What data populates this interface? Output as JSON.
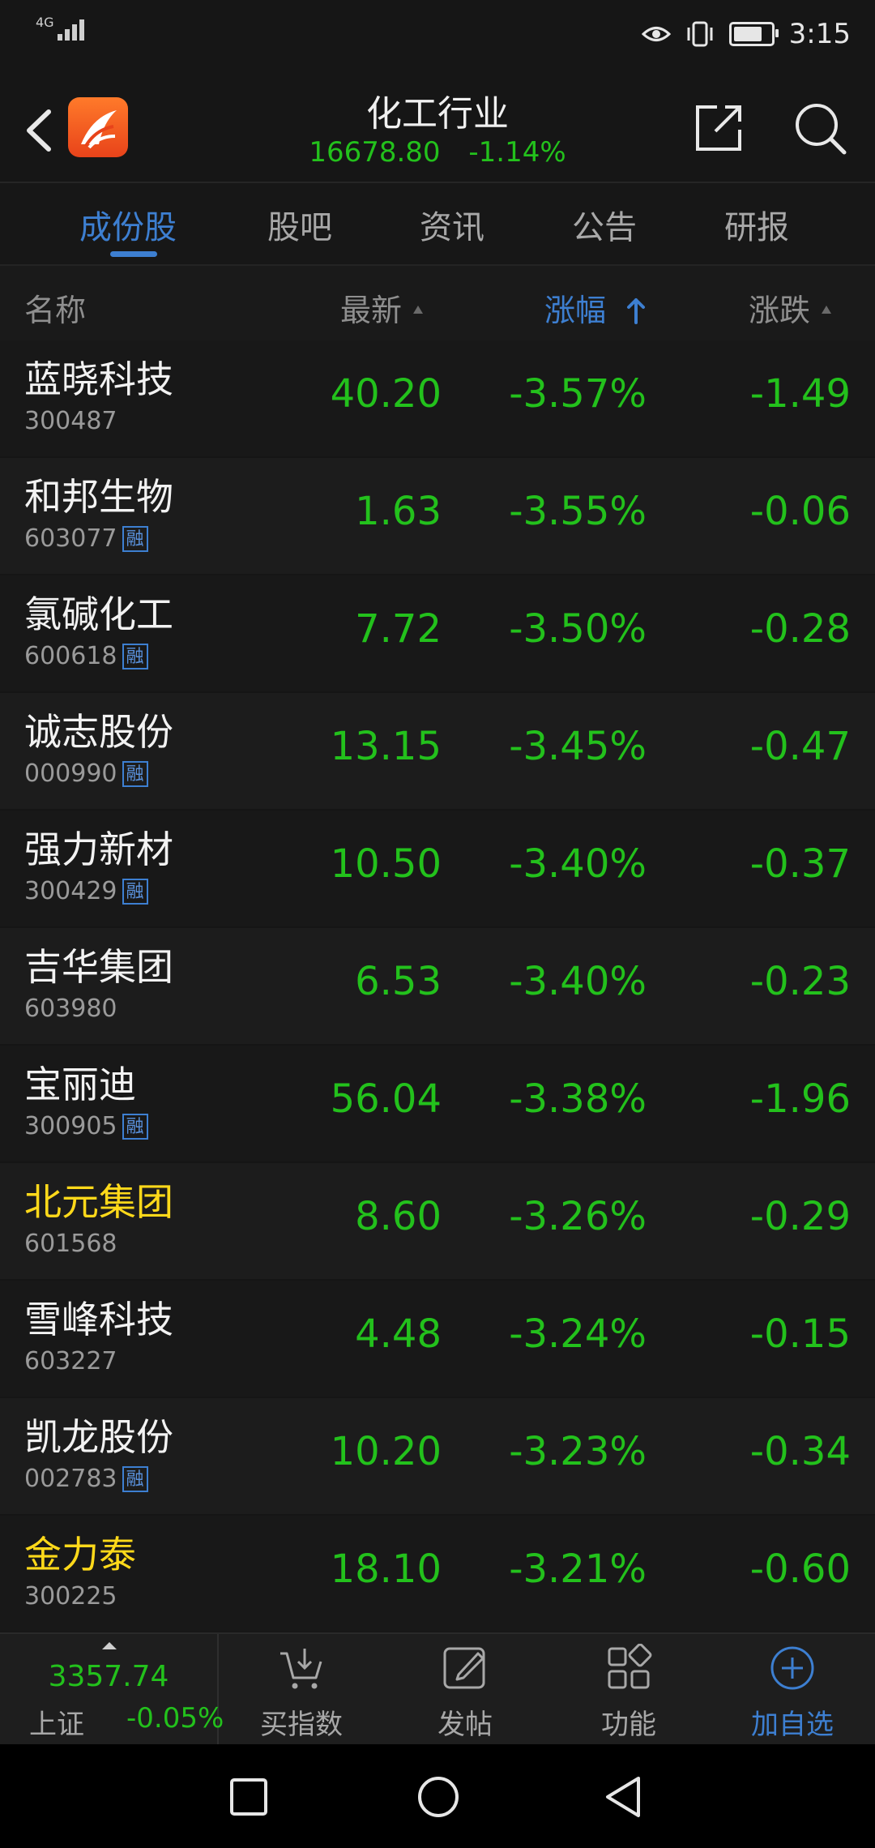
{
  "status_bar": {
    "network": "4G",
    "time": "3:15",
    "icons": [
      "signal-icon",
      "eye-icon",
      "vibrate-icon",
      "battery-icon"
    ]
  },
  "header": {
    "title": "化工行业",
    "index_value": "16678.80",
    "index_change": "-1.14%"
  },
  "tabs": [
    {
      "label": "成份股",
      "active": true
    },
    {
      "label": "股吧",
      "active": false
    },
    {
      "label": "资讯",
      "active": false
    },
    {
      "label": "公告",
      "active": false
    },
    {
      "label": "研报",
      "active": false
    }
  ],
  "columns": {
    "name": "名称",
    "latest": "最新",
    "change_pct": "涨幅",
    "change": "涨跌"
  },
  "rows": [
    {
      "name": "蓝晓科技",
      "code": "300487",
      "margin": false,
      "highlight": false,
      "latest": "40.20",
      "pct": "-3.57%",
      "chg": "-1.49"
    },
    {
      "name": "和邦生物",
      "code": "603077",
      "margin": true,
      "highlight": false,
      "latest": "1.63",
      "pct": "-3.55%",
      "chg": "-0.06"
    },
    {
      "name": "氯碱化工",
      "code": "600618",
      "margin": true,
      "highlight": false,
      "latest": "7.72",
      "pct": "-3.50%",
      "chg": "-0.28"
    },
    {
      "name": "诚志股份",
      "code": "000990",
      "margin": true,
      "highlight": false,
      "latest": "13.15",
      "pct": "-3.45%",
      "chg": "-0.47"
    },
    {
      "name": "强力新材",
      "code": "300429",
      "margin": true,
      "highlight": false,
      "latest": "10.50",
      "pct": "-3.40%",
      "chg": "-0.37"
    },
    {
      "name": "吉华集团",
      "code": "603980",
      "margin": false,
      "highlight": false,
      "latest": "6.53",
      "pct": "-3.40%",
      "chg": "-0.23"
    },
    {
      "name": "宝丽迪",
      "code": "300905",
      "margin": true,
      "highlight": false,
      "latest": "56.04",
      "pct": "-3.38%",
      "chg": "-1.96"
    },
    {
      "name": "北元集团",
      "code": "601568",
      "margin": false,
      "highlight": true,
      "latest": "8.60",
      "pct": "-3.26%",
      "chg": "-0.29"
    },
    {
      "name": "雪峰科技",
      "code": "603227",
      "margin": false,
      "highlight": false,
      "latest": "4.48",
      "pct": "-3.24%",
      "chg": "-0.15"
    },
    {
      "name": "凯龙股份",
      "code": "002783",
      "margin": true,
      "highlight": false,
      "latest": "10.20",
      "pct": "-3.23%",
      "chg": "-0.34"
    },
    {
      "name": "金力泰",
      "code": "300225",
      "margin": false,
      "highlight": true,
      "latest": "18.10",
      "pct": "-3.21%",
      "chg": "-0.60"
    }
  ],
  "margin_badge": "融",
  "bottom_nav": {
    "index": {
      "value": "3357.74",
      "name": "上证",
      "change": "-0.05%"
    },
    "items": [
      {
        "label": "买指数",
        "icon": "cart-download-icon",
        "active": false
      },
      {
        "label": "发帖",
        "icon": "edit-post-icon",
        "active": false
      },
      {
        "label": "功能",
        "icon": "grid-icon",
        "active": false
      },
      {
        "label": "加自选",
        "icon": "add-circle-icon",
        "active": true
      }
    ]
  },
  "colors": {
    "accent": "#3d7fd1",
    "down": "#23c11c",
    "highlight": "#ffd91a"
  }
}
